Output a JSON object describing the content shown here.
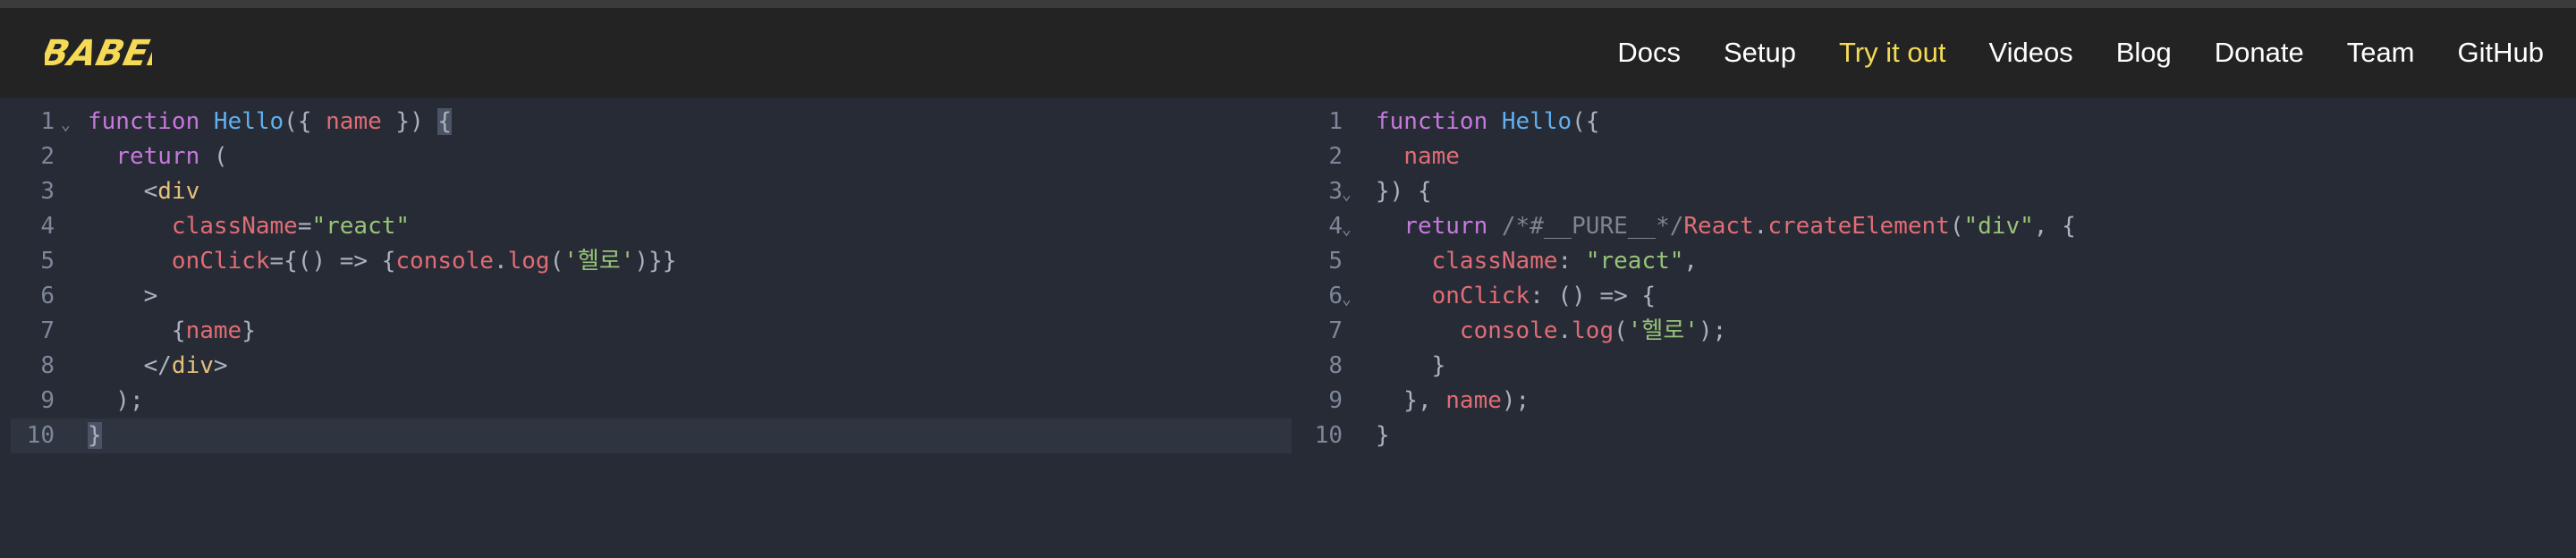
{
  "logo": {
    "text": "BABEL",
    "color": "#f5da55"
  },
  "nav": {
    "items": [
      {
        "label": "Docs",
        "active": false
      },
      {
        "label": "Setup",
        "active": false
      },
      {
        "label": "Try it out",
        "active": true
      },
      {
        "label": "Videos",
        "active": false
      },
      {
        "label": "Blog",
        "active": false
      },
      {
        "label": "Donate",
        "active": false
      },
      {
        "label": "Team",
        "active": false
      },
      {
        "label": "GitHub",
        "active": false
      }
    ]
  },
  "input_editor": {
    "line_numbers": [
      "1",
      "2",
      "3",
      "4",
      "5",
      "6",
      "7",
      "8",
      "9",
      "10"
    ],
    "fold_markers": [
      "⌄"
    ],
    "lines": [
      [
        "function",
        " ",
        "Hello",
        "({ ",
        "name",
        " }) ",
        "{"
      ],
      [
        "  ",
        "return",
        " ("
      ],
      [
        "    <",
        "div"
      ],
      [
        "      ",
        "className",
        "=",
        "\"react\""
      ],
      [
        "      ",
        "onClick",
        "={() => {",
        "console",
        ".",
        "log",
        "(",
        "'헬로'",
        ")}}"
      ],
      [
        "    >"
      ],
      [
        "      {",
        "name",
        "}"
      ],
      [
        "    </",
        "div",
        ">"
      ],
      [
        "  );"
      ],
      [
        "}"
      ]
    ]
  },
  "output_editor": {
    "line_numbers": [
      "1",
      "2",
      "3",
      "4",
      "5",
      "6",
      "7",
      "8",
      "9",
      "10"
    ],
    "fold_markers": [
      "⌄",
      "⌄",
      "⌄"
    ],
    "lines": [
      [
        "function",
        " ",
        "Hello",
        "({"
      ],
      [
        "  ",
        "name"
      ],
      [
        "}) {"
      ],
      [
        "  ",
        "return",
        " ",
        "/*#__PURE__*/",
        "React",
        ".",
        "createElement",
        "(",
        "\"div\"",
        ", {"
      ],
      [
        "    ",
        "className",
        ": ",
        "\"react\"",
        ","
      ],
      [
        "    ",
        "onClick",
        ": () => {"
      ],
      [
        "      ",
        "console",
        ".",
        "log",
        "(",
        "'헬로'",
        ");"
      ],
      [
        "    }"
      ],
      [
        "  }, ",
        "name",
        ");"
      ],
      [
        "}"
      ]
    ]
  }
}
